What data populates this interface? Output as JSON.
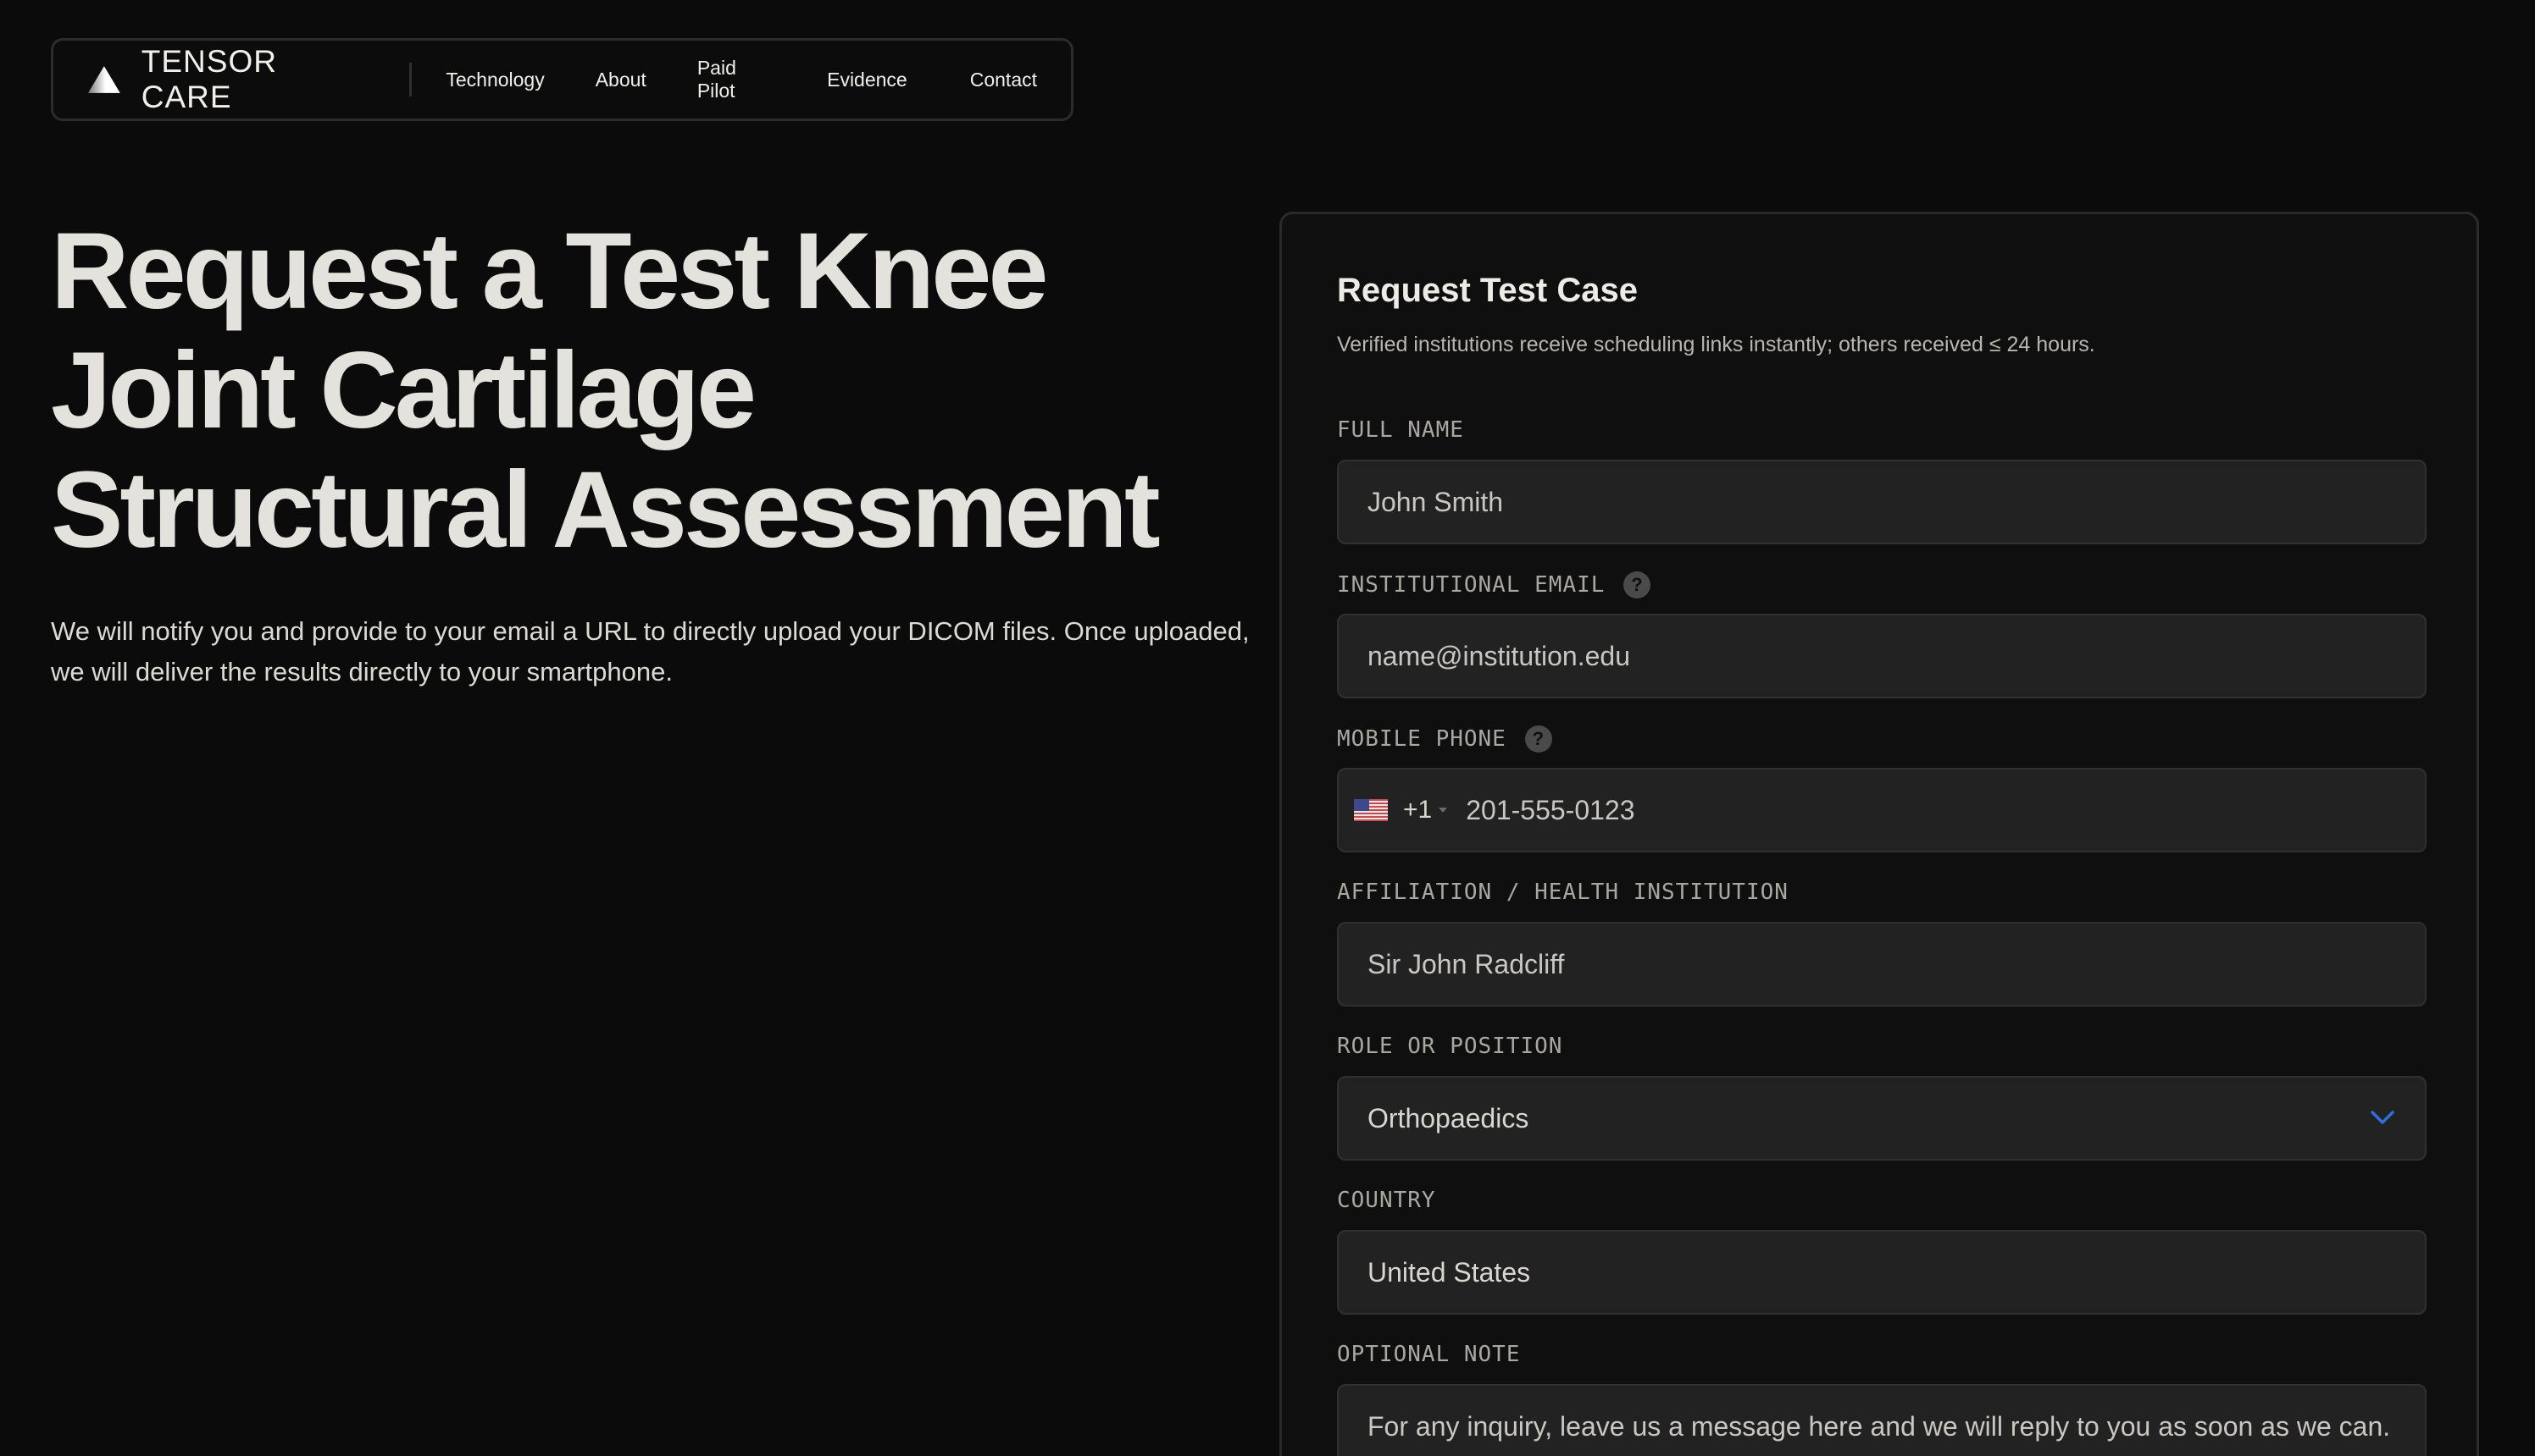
{
  "nav": {
    "brand": "TENSOR CARE",
    "links": [
      "Technology",
      "About",
      "Paid Pilot",
      "Evidence",
      "Contact"
    ]
  },
  "hero": {
    "title_line1": "Request a Test Knee",
    "title_line2": "Joint Cartilage",
    "title_line3": "Structural Assessment",
    "text": "We will notify you and provide to your email a URL to directly upload your DICOM files. Once uploaded, we will deliver the results directly to your smartphone."
  },
  "form": {
    "title": "Request Test Case",
    "subtitle": "Verified institutions receive scheduling links instantly; others received ≤ 24 hours.",
    "full_name": {
      "label": "FULL NAME",
      "placeholder": "John Smith"
    },
    "email": {
      "label": "INSTITUTIONAL EMAIL",
      "placeholder": "name@institution.edu",
      "help": "?"
    },
    "phone": {
      "label": "MOBILE PHONE",
      "dial_code": "+1",
      "placeholder": "201-555-0123",
      "help": "?"
    },
    "affiliation": {
      "label": "AFFILIATION / HEALTH INSTITUTION",
      "placeholder": "Sir John Radcliff"
    },
    "role": {
      "label": "ROLE OR POSITION",
      "value": "Orthopaedics"
    },
    "country": {
      "label": "COUNTRY",
      "value": "United States"
    },
    "note": {
      "label": "OPTIONAL NOTE",
      "placeholder": "For any inquiry, leave us a message here and we will reply to you as soon as we can."
    }
  },
  "colors": {
    "background": "#0b0b0b",
    "input_bg": "#222222",
    "accent_chevron": "#2f6fe0"
  }
}
